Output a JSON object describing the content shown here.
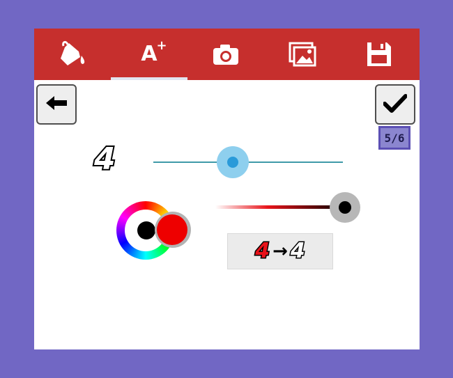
{
  "toolbar": {
    "tabs": [
      {
        "icon": "paint-bucket-icon"
      },
      {
        "icon": "text-size-icon",
        "label": "A",
        "sup": "+"
      },
      {
        "icon": "camera-icon"
      },
      {
        "icon": "image-gallery-icon"
      },
      {
        "icon": "save-icon"
      }
    ],
    "active_tab": 1,
    "color": "#c62f2d"
  },
  "page_indicator": "5/6",
  "font_size": {
    "glyph": "4",
    "slider_value": 0.42
  },
  "color_picker": {
    "primary_color": "#000000",
    "secondary_color": "#ee0000",
    "gradient_value": 1.0
  },
  "preview": {
    "from_glyph": "4",
    "arrow": "→",
    "to_glyph": "4"
  }
}
